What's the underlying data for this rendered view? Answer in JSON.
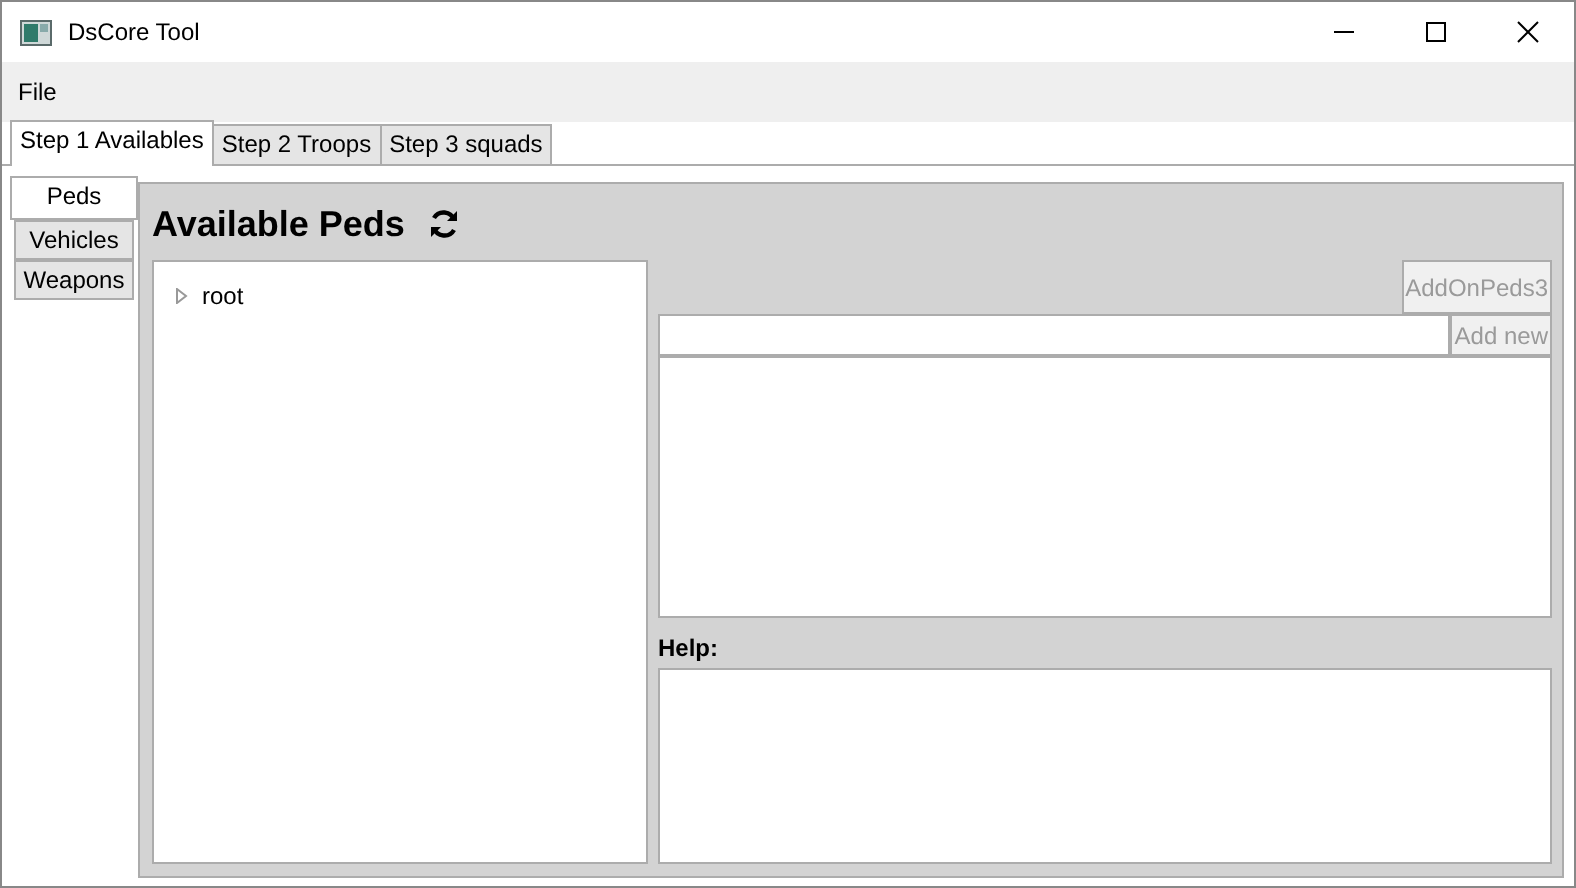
{
  "window": {
    "title": "DsCore Tool"
  },
  "menu": [
    "File"
  ],
  "tabs": [
    {
      "label": "Step 1 Availables",
      "selected": true
    },
    {
      "label": "Step 2 Troops",
      "selected": false
    },
    {
      "label": "Step 3 squads",
      "selected": false
    }
  ],
  "side_tabs": [
    {
      "label": "Peds",
      "selected": true
    },
    {
      "label": "Vehicles",
      "selected": false
    },
    {
      "label": "Weapons",
      "selected": false
    }
  ],
  "heading": "Available Peds",
  "tree": [
    {
      "label": "root",
      "expanded": false
    }
  ],
  "addon_button": {
    "label": "AddOnPeds3",
    "disabled": true
  },
  "add_new_button": {
    "label": "Add new",
    "disabled": true
  },
  "help_label": "Help:"
}
